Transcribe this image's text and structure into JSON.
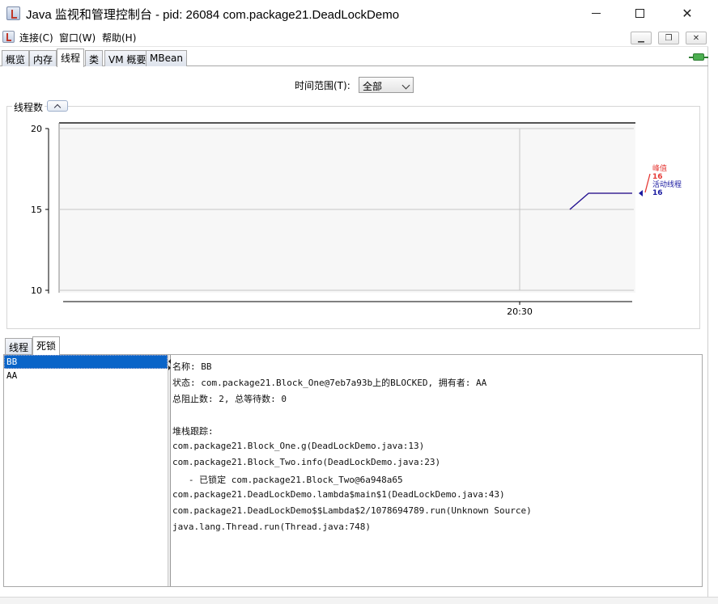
{
  "window": {
    "title": "Java 监视和管理控制台 - pid: 26084 com.package21.DeadLockDemo"
  },
  "menu": {
    "items": [
      "连接(C)",
      "窗口(W)",
      "帮助(H)"
    ]
  },
  "tabs": [
    "概览",
    "内存",
    "线程",
    "类",
    "VM 概要",
    "MBean"
  ],
  "active_tab": "线程",
  "time_range": {
    "label": "时间范围(T):",
    "selected": "全部"
  },
  "chart_data": {
    "type": "line",
    "title": "线程数",
    "ylim": [
      10,
      20
    ],
    "y_ticks": [
      "20",
      "15",
      "10"
    ],
    "x_ticks": [
      "20:30"
    ],
    "series": [
      {
        "name": "峰值",
        "color": "#e53935",
        "points": [
          [
            0.0,
            15
          ],
          [
            0.3,
            16
          ],
          [
            1.0,
            16
          ]
        ],
        "current": "16"
      },
      {
        "name": "活动线程",
        "color": "#1a1aa0",
        "points": [
          [
            0.0,
            15
          ],
          [
            0.3,
            16
          ],
          [
            1.0,
            16
          ]
        ],
        "current": "16"
      }
    ]
  },
  "bottom_tabs": [
    "线程",
    "死锁"
  ],
  "active_bottom_tab": "死锁",
  "threads": [
    "BB",
    "AA"
  ],
  "selected_thread": "BB",
  "details": [
    "名称: BB",
    "状态: com.package21.Block_One@7eb7a93b上的BLOCKED, 拥有者: AA",
    "总阻止数: 2, 总等待数: 0",
    "",
    "堆栈跟踪:",
    "com.package21.Block_One.g(DeadLockDemo.java:13)",
    "com.package21.Block_Two.info(DeadLockDemo.java:23)",
    "   - 已锁定 com.package21.Block_Two@6a948a65",
    "com.package21.DeadLockDemo.lambda$main$1(DeadLockDemo.java:43)",
    "com.package21.DeadLockDemo$$Lambda$2/1078694789.run(Unknown Source)",
    "java.lang.Thread.run(Thread.java:748)"
  ]
}
